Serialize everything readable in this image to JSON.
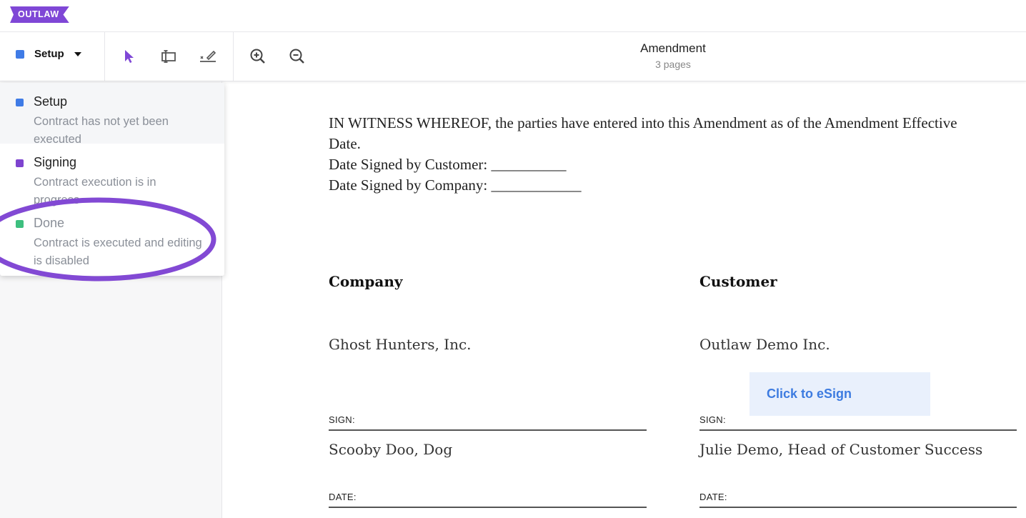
{
  "brand": {
    "logo_text": "OUTLAW",
    "color": "#7f47d6"
  },
  "toolbar": {
    "status": {
      "label": "Setup",
      "color": "#3f7be6"
    },
    "tools": [
      "select-pointer-icon",
      "text-field-icon",
      "signature-field-icon",
      "zoom-in-icon",
      "zoom-out-icon"
    ]
  },
  "document": {
    "title": "Amendment",
    "pages": "3 pages"
  },
  "status_menu": {
    "items": [
      {
        "name": "Setup",
        "desc": "Contract has not yet been executed",
        "color": "#3f7be6"
      },
      {
        "name": "Signing",
        "desc": "Contract execution is in progress",
        "color": "#7e44cf"
      },
      {
        "name": "Done",
        "desc": "Contract is executed and editing is disabled",
        "color": "#3dbf7f"
      }
    ],
    "highlight_color": "#8249d4"
  },
  "contract": {
    "witness_lines": [
      "IN WITNESS WHEREOF, the parties have entered into this Amendment as of the Amendment Effective Date.",
      "Date Signed by Customer: __________",
      "Date Signed by Company: ____________"
    ],
    "company": {
      "heading": "Company",
      "party": "Ghost Hunters, Inc.",
      "sign_label": "SIGN:",
      "signer": "Scooby Doo, Dog",
      "date_label": "DATE:"
    },
    "customer": {
      "heading": "Customer",
      "party": "Outlaw Demo Inc.",
      "esign_button": "Click to eSign",
      "sign_label": "SIGN:",
      "signer": "Julie Demo, Head of Customer Success",
      "date_label": "DATE:"
    }
  }
}
